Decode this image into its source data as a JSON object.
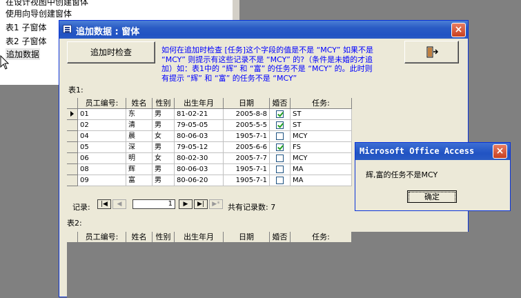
{
  "background_list": {
    "items": [
      "在设计视图中创建窗体",
      "使用向导创建窗体",
      "表1 子窗体",
      "表2 子窗体",
      "追加数据"
    ]
  },
  "window": {
    "title": "追加数据 : 窗体",
    "close_label": "×",
    "check_button_label": "追加时检查",
    "description": "如何在追加时检查 [任务]这个字段的值是不是 “MCY” 如果不是 “MCY” 则提示有这些记录不是 “MCY” 的?（条件是未婚的才追加）如：表1中的 “辉” 和 “富” 的任务不是 “MCY” 的。此时则有提示 “辉” 和 “富” 的任务不是 “MCY”",
    "table1_label": "表1:",
    "table2_label": "表2:"
  },
  "table1": {
    "columns": [
      "员工编号:",
      "姓名",
      "性别",
      "出生年月",
      "日期",
      "婚否",
      "任务:"
    ],
    "rows": [
      {
        "id": "01",
        "name": "东",
        "sex": "男",
        "birth": "81-02-21",
        "date": "2005-8-8",
        "married": true,
        "task": "ST"
      },
      {
        "id": "02",
        "name": "清",
        "sex": "男",
        "birth": "79-05-05",
        "date": "2005-5-5",
        "married": true,
        "task": "ST"
      },
      {
        "id": "04",
        "name": "晨",
        "sex": "女",
        "birth": "80-06-03",
        "date": "1905-7-1",
        "married": false,
        "task": "MCY"
      },
      {
        "id": "05",
        "name": "深",
        "sex": "男",
        "birth": "79-05-12",
        "date": "2005-6-6",
        "married": true,
        "task": "FS"
      },
      {
        "id": "06",
        "name": "明",
        "sex": "女",
        "birth": "80-02-30",
        "date": "2005-7-7",
        "married": false,
        "task": "MCY"
      },
      {
        "id": "08",
        "name": "辉",
        "sex": "男",
        "birth": "80-06-03",
        "date": "1905-7-1",
        "married": false,
        "task": "MA"
      },
      {
        "id": "09",
        "name": "富",
        "sex": "男",
        "birth": "80-06-20",
        "date": "1905-7-1",
        "married": false,
        "task": "MA"
      }
    ],
    "nav": {
      "label": "记录:",
      "current": "1",
      "total_text": "共有记录数: 7"
    }
  },
  "table2": {
    "columns": [
      "员工编号:",
      "姓名",
      "性别",
      "出生年月",
      "日期",
      "婚否",
      "任务:"
    ]
  },
  "dialog": {
    "title": "Microsoft Office Access",
    "close_label": "×",
    "message": "辉,富的任务不是MCY",
    "ok_label": "确定"
  }
}
